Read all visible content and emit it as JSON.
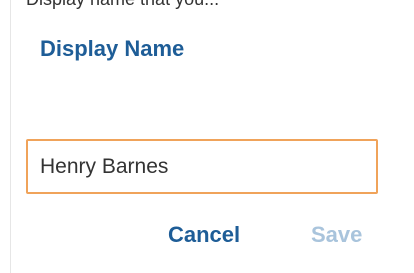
{
  "app": {
    "header_partial": "Display name that you..."
  },
  "dialog": {
    "title": "Display Name",
    "input": {
      "value": "Henry Barnes",
      "placeholder": ""
    },
    "buttons": {
      "cancel_label": "Cancel",
      "save_label": "Save"
    }
  },
  "colors": {
    "title": "#1e5d97",
    "input_border_focus": "#f0a35a",
    "cancel": "#1e5d97",
    "save_disabled": "#a9c4dc"
  }
}
